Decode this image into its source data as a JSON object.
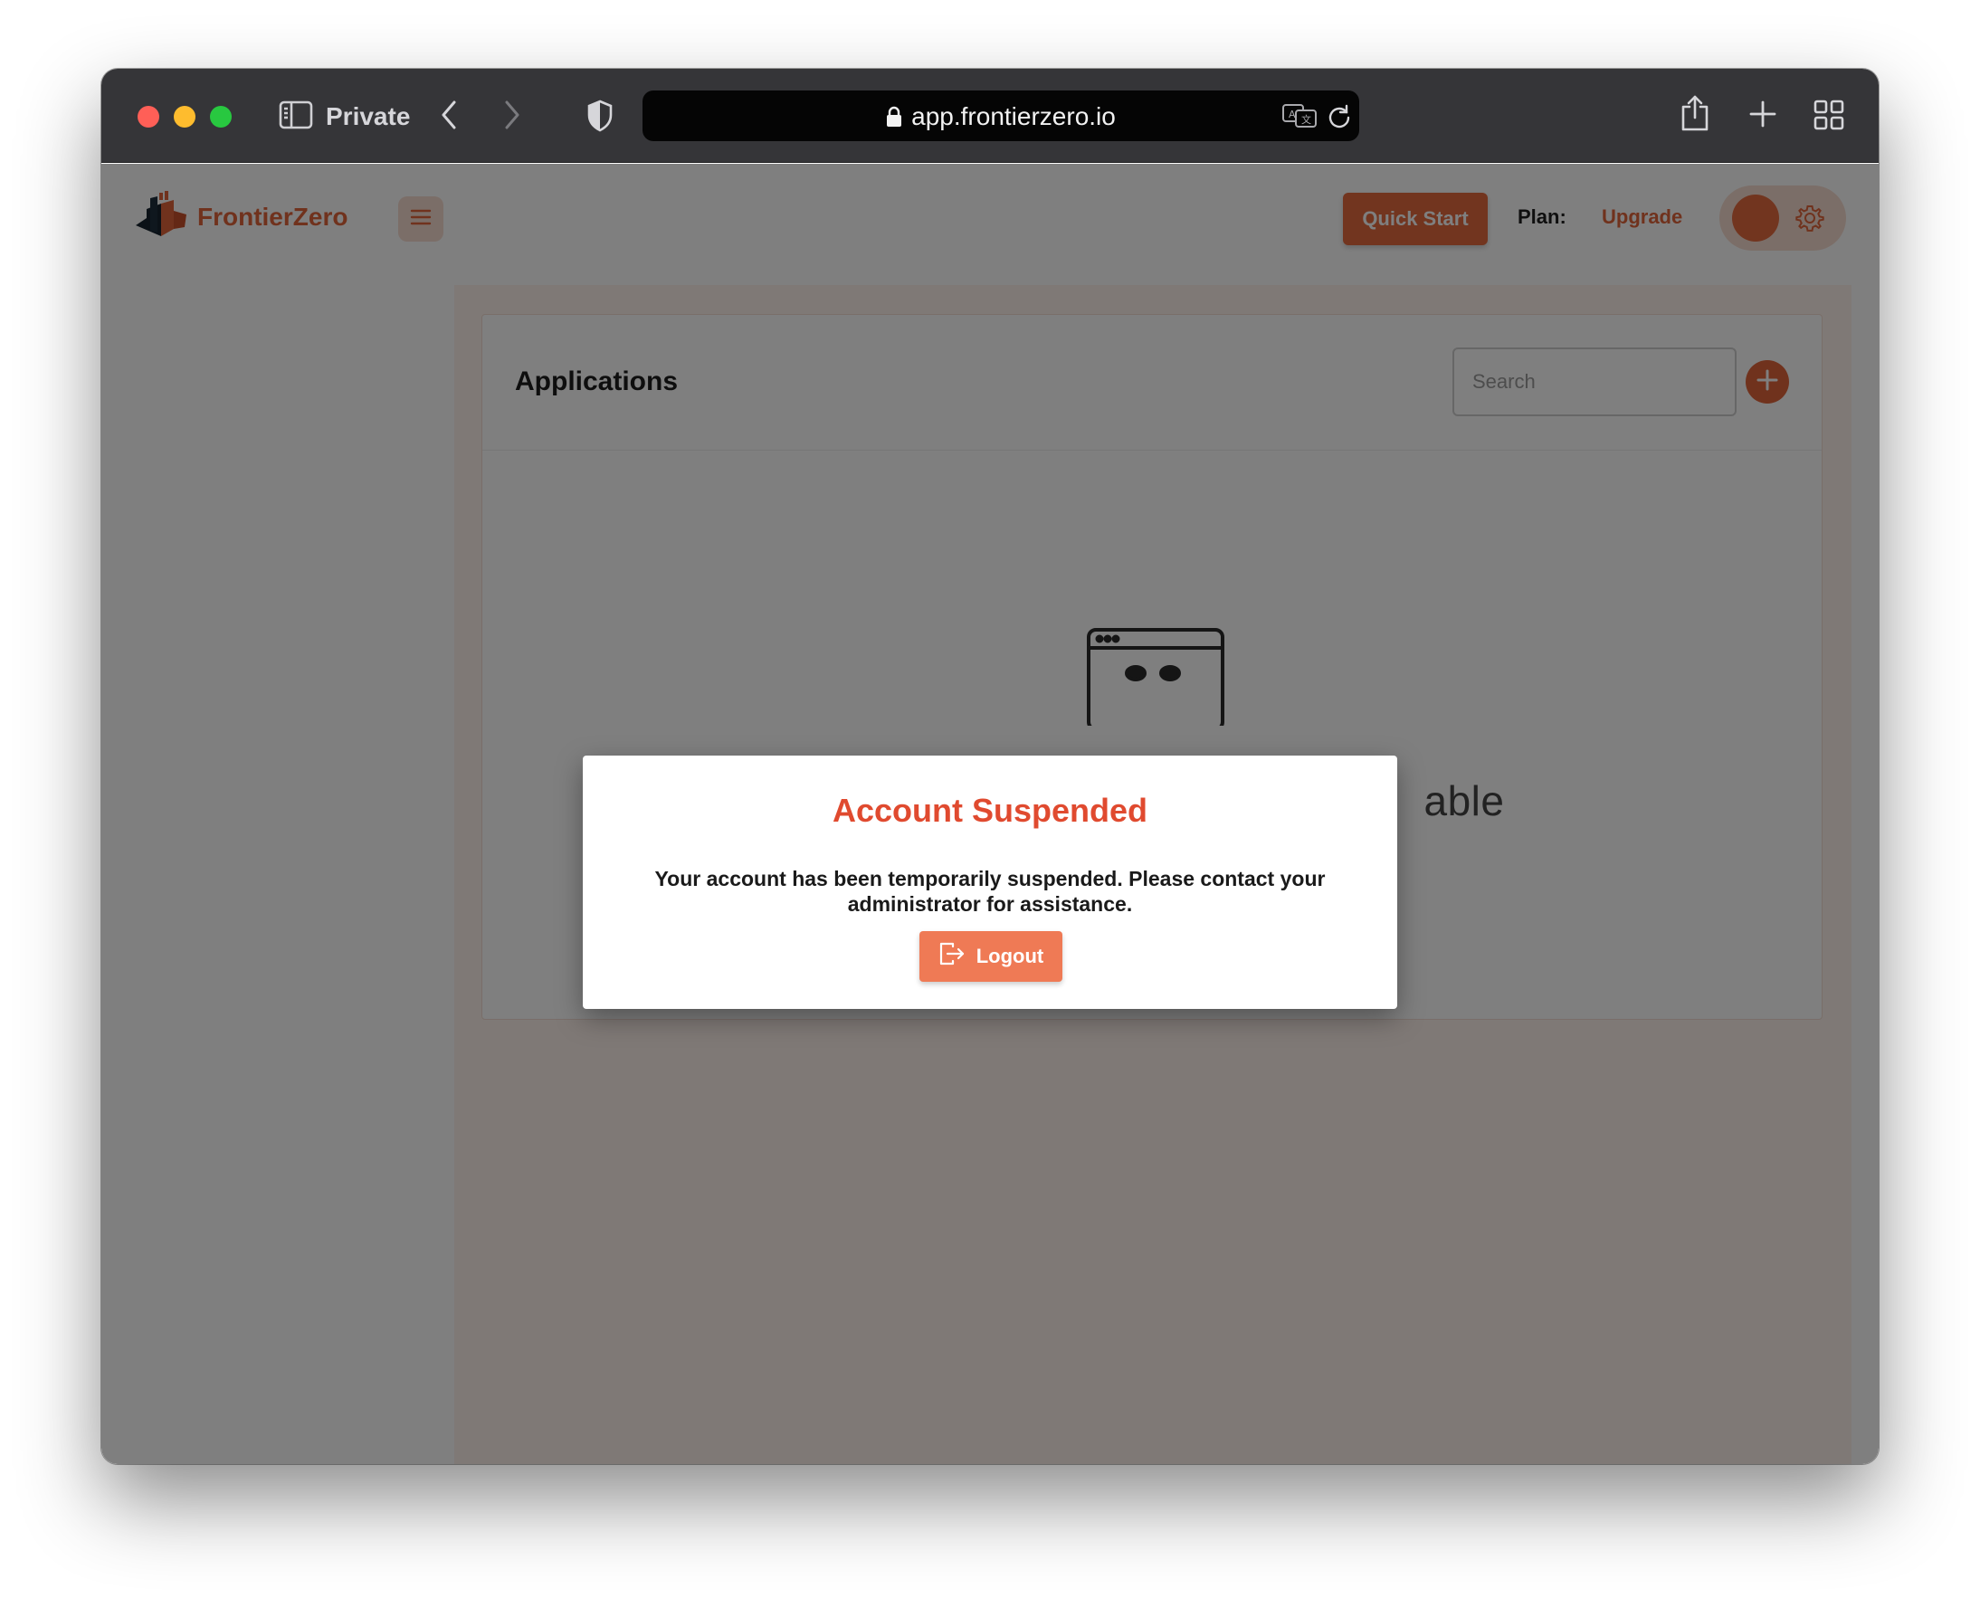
{
  "browser": {
    "private_label": "Private",
    "url": "app.frontierzero.io"
  },
  "header": {
    "brand": "FrontierZero",
    "quick_start_label": "Quick Start",
    "plan_label": "Plan:",
    "upgrade_label": "Upgrade"
  },
  "applications": {
    "title": "Applications",
    "search_placeholder": "Search",
    "empty_text_visible": "able"
  },
  "modal": {
    "title": "Account Suspended",
    "message": "Your account has been temporarily suspended. Please contact your administrator for assistance.",
    "logout_label": "Logout"
  },
  "colors": {
    "accent": "#e0643a",
    "modal_title": "#e04a2f",
    "titlebar": "#353538"
  },
  "icons": {
    "sidebar_toggle": "sidebar-toggle-icon",
    "back": "chevron-left-icon",
    "forward": "chevron-right-icon",
    "privacy": "shield-icon",
    "lock": "lock-icon",
    "translate": "translate-icon",
    "reload": "reload-icon",
    "share": "share-icon",
    "new_tab": "plus-icon",
    "tab_overview": "grid-icon",
    "menu": "hamburger-icon",
    "settings": "gear-icon",
    "add": "plus-circle-icon",
    "logout": "logout-icon"
  }
}
